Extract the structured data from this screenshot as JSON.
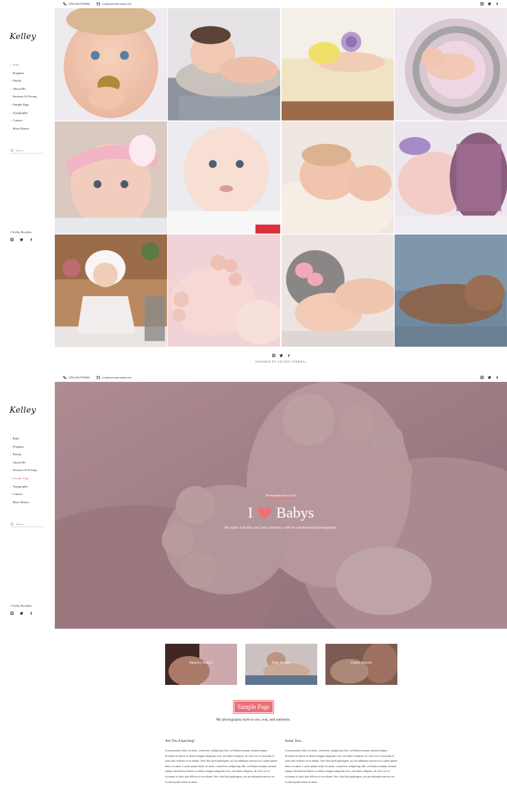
{
  "topbar": {
    "phone": "(356) 444-5550466",
    "email": "you@awesome-email.com"
  },
  "sidebar": {
    "logo": "Kelley",
    "menu_sec1": [
      {
        "label": "Baby",
        "active": true
      },
      {
        "label": "Pregnant",
        "active": false
      },
      {
        "label": "Family",
        "active": false
      },
      {
        "label": "About Me",
        "active": false
      },
      {
        "label": "Sessions & Pricing",
        "active": false
      },
      {
        "label": "Sample Page",
        "active": false
      },
      {
        "label": "Typography",
        "active": false
      },
      {
        "label": "Contact",
        "active": false
      },
      {
        "label": "More Demos",
        "active": false
      }
    ],
    "menu_sec2": [
      {
        "label": "Baby",
        "active": false
      },
      {
        "label": "Pregnant",
        "active": false
      },
      {
        "label": "Family",
        "active": false
      },
      {
        "label": "About Me",
        "active": false
      },
      {
        "label": "Sessions & Pricing",
        "active": false
      },
      {
        "label": "Sample Page",
        "active": true
      },
      {
        "label": "Typography",
        "active": false
      },
      {
        "label": "Contact",
        "active": false
      },
      {
        "label": "More Demos",
        "active": false
      }
    ],
    "search_placeholder": "Search",
    "footer": "© Kelley Brooklyn"
  },
  "gallery_footer": {
    "powered": "POWERED BY UNITED THEMES"
  },
  "hero": {
    "badge": "Photographer Since 2012",
    "title_left": "I",
    "title_right": "Babys",
    "subtitle": "My name is Kelley and I am a mummy, wife & a professional photographer."
  },
  "sessions": [
    {
      "label": "Mummy Session"
    },
    {
      "label": "Baby Session"
    },
    {
      "label": "Family Session"
    }
  ],
  "sample": {
    "button": "Sample Page",
    "tagline": "My photography style is raw, real, and authentic."
  },
  "columns": [
    {
      "heading": "Are You Expecting?",
      "body": "Lorem ipsum dolor sit amet, consetetur sadipscing elitr, sed diam nonumy eirmod tempor invidunt ut labore et dolore magna aliquyam erat, sed diam voluptua. At vero eos et accusam et justo duo dolores et ea rebum. Stet clita kasd gubergren, no sea takimata sanctus est Lorem ipsum dolor sit amet. Lorem ipsum dolor sit amet, consetetur sadipscing elitr, sed diam nonumy eirmod tempor invidunt ut labore et dolore magna aliquyam erat, sed diam voluptua. At vero eos et accusam et justo duo dolores et ea rebum. Stet clita kasd gubergren, no sea takimata sanctus est Lorem ipsum dolor sit amet."
    },
    {
      "heading": "Some Text...",
      "body": "Lorem ipsum dolor sit amet, consetetur sadipscing elitr, sed diam nonumy eirmod tempor invidunt ut labore et dolore magna aliquyam erat, sed diam voluptua. At vero eos et accusam et justo duo dolores et ea rebum. Stet clita kasd gubergren, no sea takimata sanctus est Lorem ipsum dolor sit amet. Lorem ipsum dolor sit amet, consetetur sadipscing elitr, sed diam nonumy eirmod tempor invidunt ut labore et dolore magna aliquyam erat, sed diam voluptua. At vero eos et accusam et justo duo dolores et ea rebum. Stet clita kasd gubergren, no sea takimata sanctus est Lorem ipsum dolor sit amet."
    }
  ],
  "colors": {
    "accent": "#ef6f78",
    "text": "#222222"
  },
  "icons": [
    "phone-icon",
    "email-icon",
    "instagram-icon",
    "twitter-icon",
    "facebook-icon",
    "search-icon",
    "heart-icon",
    "chevron-down-icon"
  ]
}
